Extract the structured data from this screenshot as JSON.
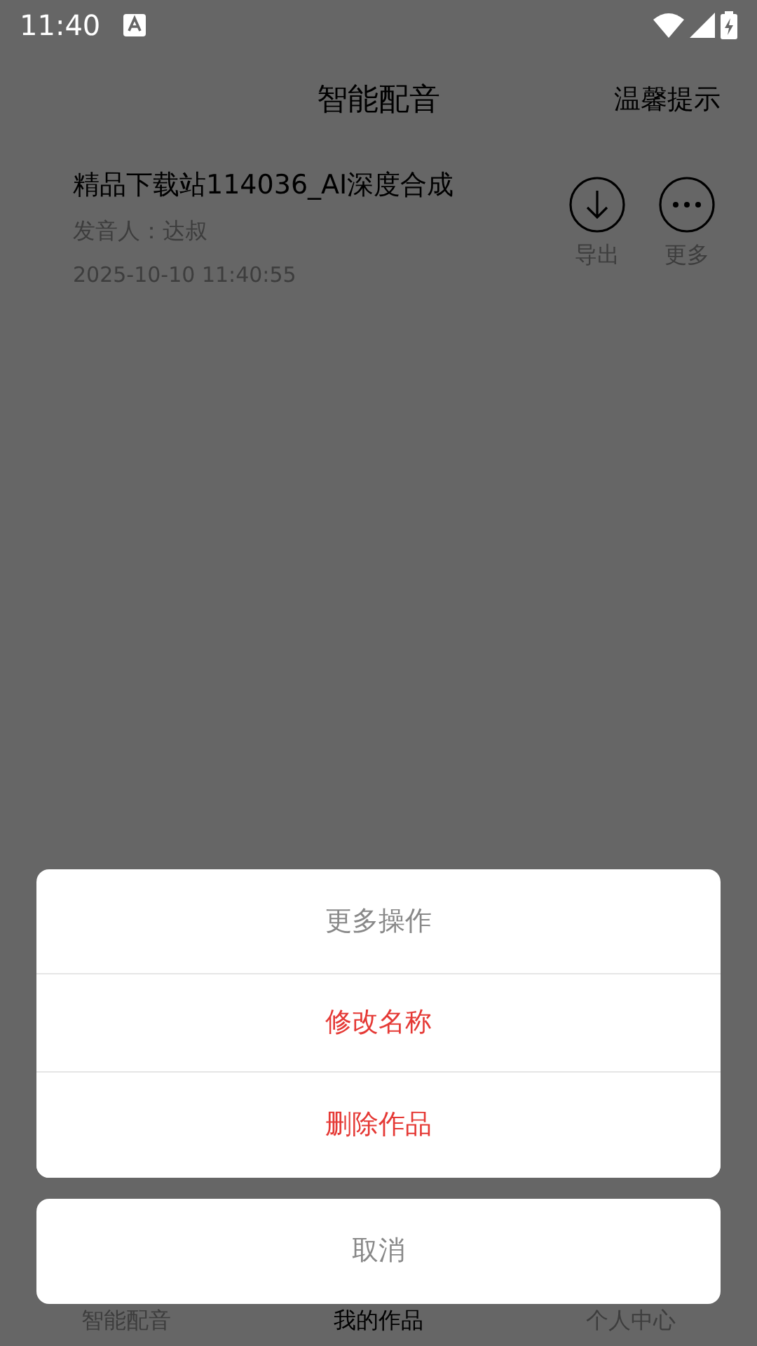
{
  "status_bar": {
    "time": "11:40"
  },
  "header": {
    "title": "智能配音",
    "action": "温馨提示"
  },
  "works": [
    {
      "title": "精品下载站114036_AI深度合成",
      "speaker": "发音人：达叔",
      "date": "2025-10-10 11:40:55",
      "actions": [
        {
          "kind": "export",
          "label": "导出"
        },
        {
          "kind": "more",
          "label": "更多"
        }
      ]
    }
  ],
  "bottom_nav": [
    {
      "label": "智能配音",
      "selected": false
    },
    {
      "label": "我的作品",
      "selected": true
    },
    {
      "label": "个人中心",
      "selected": false
    }
  ],
  "action_sheet": {
    "title": "更多操作",
    "options": [
      {
        "label": "修改名称"
      },
      {
        "label": "删除作品"
      }
    ],
    "cancel": "取消"
  }
}
